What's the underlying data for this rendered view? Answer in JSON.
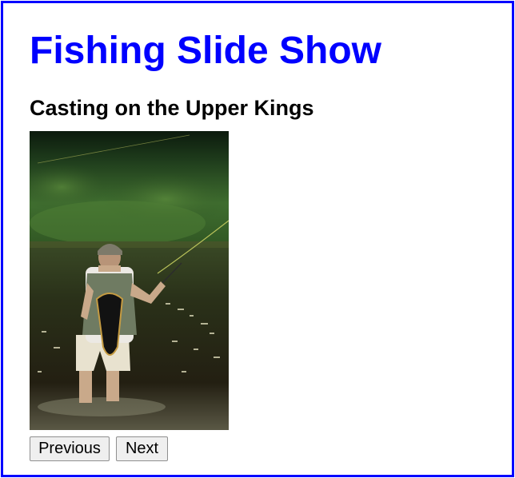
{
  "page": {
    "title": "Fishing Slide Show",
    "title_color": "#0000ff",
    "border_color": "#0000ff"
  },
  "slide": {
    "caption": "Casting on the Upper Kings",
    "image_subject": "fly-fisherman-casting-in-river"
  },
  "controls": {
    "previous_label": "Previous",
    "next_label": "Next"
  }
}
